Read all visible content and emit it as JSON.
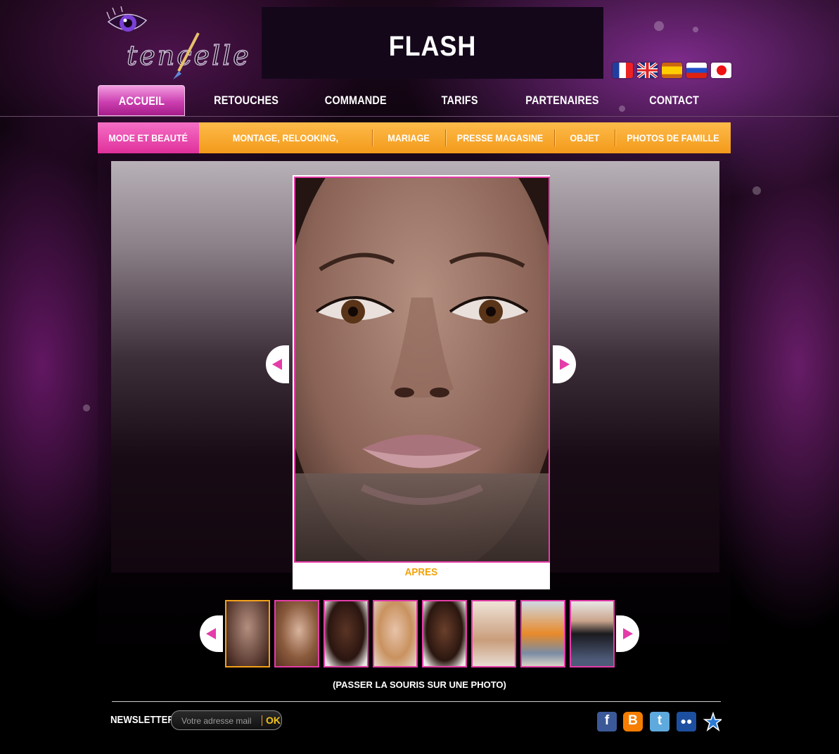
{
  "header": {
    "logo_text": "tencelle",
    "banner_title": "FLASH"
  },
  "languages": [
    {
      "icon": "flag-france-icon"
    },
    {
      "icon": "flag-uk-icon"
    },
    {
      "icon": "flag-spain-icon"
    },
    {
      "icon": "flag-russia-icon"
    },
    {
      "icon": "flag-japan-icon"
    }
  ],
  "main_nav": {
    "items": [
      "ACCUEIL",
      "RETOUCHES",
      "COMMANDE",
      "TARIFS",
      "PARTENAIRES",
      "CONTACT"
    ],
    "active": "ACCUEIL"
  },
  "sub_nav": {
    "items": [
      "MODE ET BEAUTÉ",
      "MONTAGE, RELOOKING, REPARATION",
      "MARIAGE",
      "PRESSE MAGASINE",
      "OBJET",
      "PHOTOS DE FAMILLE"
    ],
    "active": "MODE ET BEAUTÉ"
  },
  "viewer": {
    "caption": "APRES",
    "prev_icon": "chevron-left-icon",
    "next_icon": "chevron-right-icon"
  },
  "thumbnails": {
    "count": 8,
    "selected_index": 0
  },
  "hint": "(PASSER LA SOURIS SUR UNE PHOTO)",
  "newsletter": {
    "label": "NEWSLETTER :",
    "placeholder": "Votre adresse mail",
    "submit": "OK"
  },
  "social": [
    {
      "icon": "facebook-icon",
      "color": "#3b5998"
    },
    {
      "icon": "blogger-icon",
      "color": "#f57d00"
    },
    {
      "icon": "twitter-icon",
      "color": "#5ea9dd"
    },
    {
      "icon": "myspace-icon",
      "color": "#1d4fa0"
    },
    {
      "icon": "bookmark-star-icon",
      "color": "#2a7bd6"
    }
  ],
  "colors": {
    "accent_pink": "#e43ca8",
    "accent_orange": "#f3a11b"
  }
}
